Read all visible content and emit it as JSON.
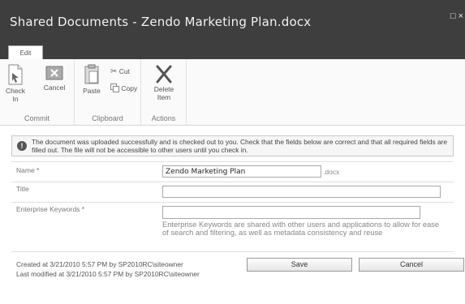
{
  "window": {
    "title": "Shared Documents - Zendo Marketing Plan.docx",
    "controls": "□ ×"
  },
  "ribbon": {
    "tab_edit": "Edit",
    "commit": {
      "label": "Commit",
      "check_in": "Check In",
      "cancel": "Cancel"
    },
    "clipboard": {
      "label": "Clipboard",
      "paste": "Paste",
      "cut": "Cut",
      "copy": "Copy"
    },
    "actions": {
      "label": "Actions",
      "delete_item": "Delete Item"
    }
  },
  "notice": {
    "text": "The document was uploaded successfully and is checked out to you. Check that the fields below are correct and that all required fields are filled out. The file will not be accessible to other users until you check in."
  },
  "form": {
    "name": {
      "label": "Name *",
      "value": "Zendo Marketing Plan",
      "suffix": ".docx"
    },
    "title": {
      "label": "Title",
      "value": ""
    },
    "keywords": {
      "label": "Enterprise Keywords *",
      "value": "",
      "description": "Enterprise Keywords are shared with other users and applications to allow for ease of search and filtering, as well as metadata consistency and reuse"
    }
  },
  "footer": {
    "created": "Created at 3/21/2010 5:57 PM by SP2010RC\\siteowner",
    "modified": "Last modified at 3/21/2010 5:57 PM by SP2010RC\\siteowner",
    "save": "Save",
    "cancel": "Cancel"
  }
}
